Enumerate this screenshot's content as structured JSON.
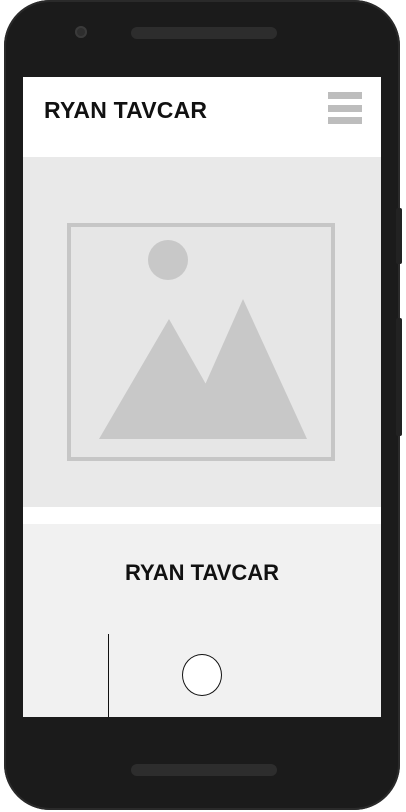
{
  "header": {
    "brand": "RYAN TAVCAR"
  },
  "icons": {
    "menu": "hamburger-menu-icon",
    "hero_image": "image-placeholder-icon"
  },
  "card": {
    "title": "RYAN TAVCAR"
  },
  "colors": {
    "device_frame": "#1b1b1b",
    "header_bg": "#ffffff",
    "hero_bg": "#e9e9e9",
    "placeholder_gray": "#c8c8c8",
    "card_bg": "#f1f1f1",
    "text": "#111111"
  }
}
